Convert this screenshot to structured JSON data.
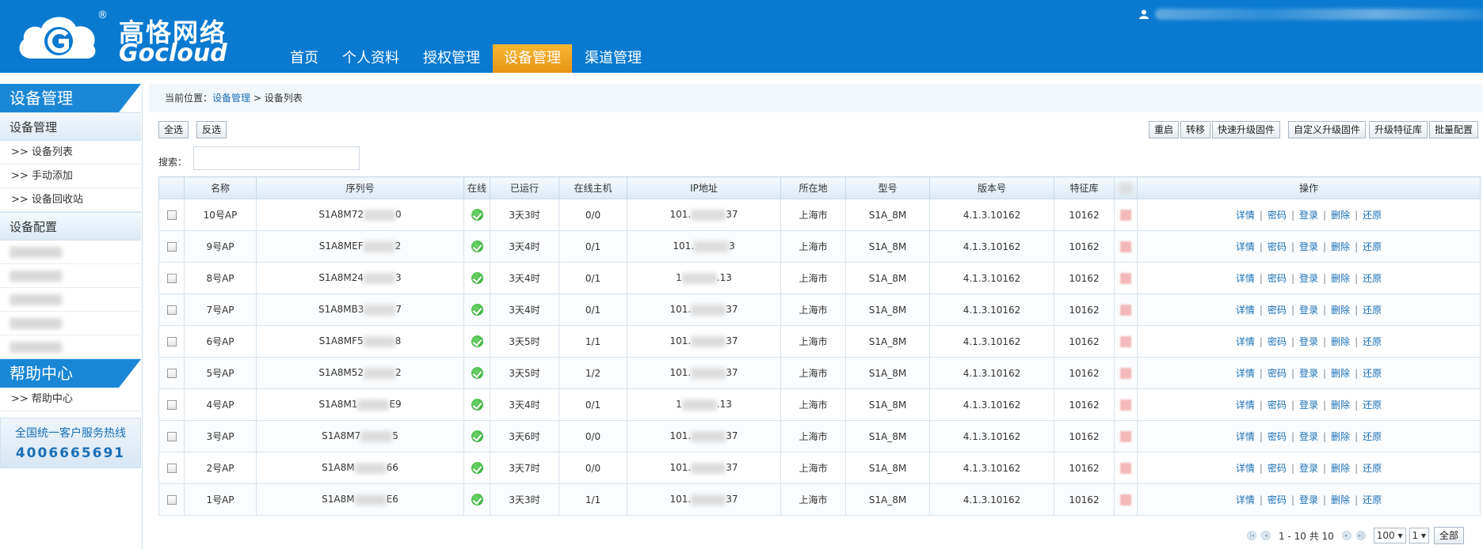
{
  "header": {
    "logo_cn": "高恪网络",
    "logo_en": "Gocloud",
    "logo_reg": "®",
    "nav": [
      "首页",
      "个人资料",
      "授权管理",
      "设备管理",
      "渠道管理"
    ],
    "active_nav": "设备管理",
    "user_icon": "user-icon"
  },
  "sidebar": {
    "head1": "设备管理",
    "section1": "设备管理",
    "items1": [
      ">> 设备列表",
      ">> 手动添加",
      ">> 设备回收站"
    ],
    "section2": "设备配置",
    "head2": "帮助中心",
    "items2": [
      ">> 帮助中心"
    ],
    "hotline_label": "全国统一客户服务热线",
    "hotline_number": "4006665691"
  },
  "breadcrumb": {
    "prefix": "当前位置：",
    "link": "设备管理",
    "sep": " > ",
    "current": "设备列表"
  },
  "toolbar": {
    "select_all": "全选",
    "invert": "反选",
    "reboot": "重启",
    "transfer": "转移",
    "quick_upgrade": "快速升级固件",
    "custom_upgrade": "自定义升级固件",
    "upgrade_feature": "升级特征库",
    "batch_config": "批量配置"
  },
  "search": {
    "label": "搜索：",
    "value": ""
  },
  "table": {
    "headers": [
      "名称",
      "序列号",
      "在线",
      "已运行",
      "在线主机",
      "IP地址",
      "所在地",
      "型号",
      "版本号",
      "特征库",
      "操作"
    ],
    "rows": [
      {
        "name": "10号AP",
        "serial_a": "S1A8M72",
        "serial_b": "0",
        "uptime": "3天3时",
        "hosts": "0/0",
        "ip_a": "101.",
        "ip_b": "37",
        "location": "上海市",
        "model": "S1A_8M",
        "version": "4.1.3.10162",
        "feature": "10162"
      },
      {
        "name": "9号AP",
        "serial_a": "S1A8MEF",
        "serial_b": "2",
        "uptime": "3天4时",
        "hosts": "0/1",
        "ip_a": "101.",
        "ip_b": "3",
        "location": "上海市",
        "model": "S1A_8M",
        "version": "4.1.3.10162",
        "feature": "10162"
      },
      {
        "name": "8号AP",
        "serial_a": "S1A8M24",
        "serial_b": "3",
        "uptime": "3天4时",
        "hosts": "0/1",
        "ip_a": "1",
        "ip_b": ".13",
        "location": "上海市",
        "model": "S1A_8M",
        "version": "4.1.3.10162",
        "feature": "10162"
      },
      {
        "name": "7号AP",
        "serial_a": "S1A8MB3",
        "serial_b": "7",
        "uptime": "3天4时",
        "hosts": "0/1",
        "ip_a": "101.",
        "ip_b": "37",
        "location": "上海市",
        "model": "S1A_8M",
        "version": "4.1.3.10162",
        "feature": "10162"
      },
      {
        "name": "6号AP",
        "serial_a": "S1A8MF5",
        "serial_b": "8",
        "uptime": "3天5时",
        "hosts": "1/1",
        "ip_a": "101.",
        "ip_b": "37",
        "location": "上海市",
        "model": "S1A_8M",
        "version": "4.1.3.10162",
        "feature": "10162"
      },
      {
        "name": "5号AP",
        "serial_a": "S1A8M52",
        "serial_b": "2",
        "uptime": "3天5时",
        "hosts": "1/2",
        "ip_a": "101.",
        "ip_b": "37",
        "location": "上海市",
        "model": "S1A_8M",
        "version": "4.1.3.10162",
        "feature": "10162"
      },
      {
        "name": "4号AP",
        "serial_a": "S1A8M1",
        "serial_b": "E9",
        "uptime": "3天4时",
        "hosts": "0/1",
        "ip_a": "1",
        "ip_b": ".13",
        "location": "上海市",
        "model": "S1A_8M",
        "version": "4.1.3.10162",
        "feature": "10162"
      },
      {
        "name": "3号AP",
        "serial_a": "S1A8M7",
        "serial_b": "5",
        "uptime": "3天6时",
        "hosts": "0/0",
        "ip_a": "101.",
        "ip_b": "37",
        "location": "上海市",
        "model": "S1A_8M",
        "version": "4.1.3.10162",
        "feature": "10162"
      },
      {
        "name": "2号AP",
        "serial_a": "S1A8M",
        "serial_b": "66",
        "uptime": "3天7时",
        "hosts": "0/0",
        "ip_a": "101.",
        "ip_b": "37",
        "location": "上海市",
        "model": "S1A_8M",
        "version": "4.1.3.10162",
        "feature": "10162"
      },
      {
        "name": "1号AP",
        "serial_a": "S1A8M",
        "serial_b": "E6",
        "uptime": "3天3时",
        "hosts": "1/1",
        "ip_a": "101.",
        "ip_b": "37",
        "location": "上海市",
        "model": "S1A_8M",
        "version": "4.1.3.10162",
        "feature": "10162"
      }
    ],
    "ops": [
      "详情",
      "密码",
      "登录",
      "删除",
      "还原"
    ]
  },
  "pager": {
    "range": "1 - 10 共 10",
    "page_size": "100 ▾",
    "page": "1 ▾",
    "all": "全部"
  },
  "colors": {
    "header_bg": "#0a7ad0",
    "active_tab": "#f0a020",
    "link": "#1a6fb5"
  }
}
